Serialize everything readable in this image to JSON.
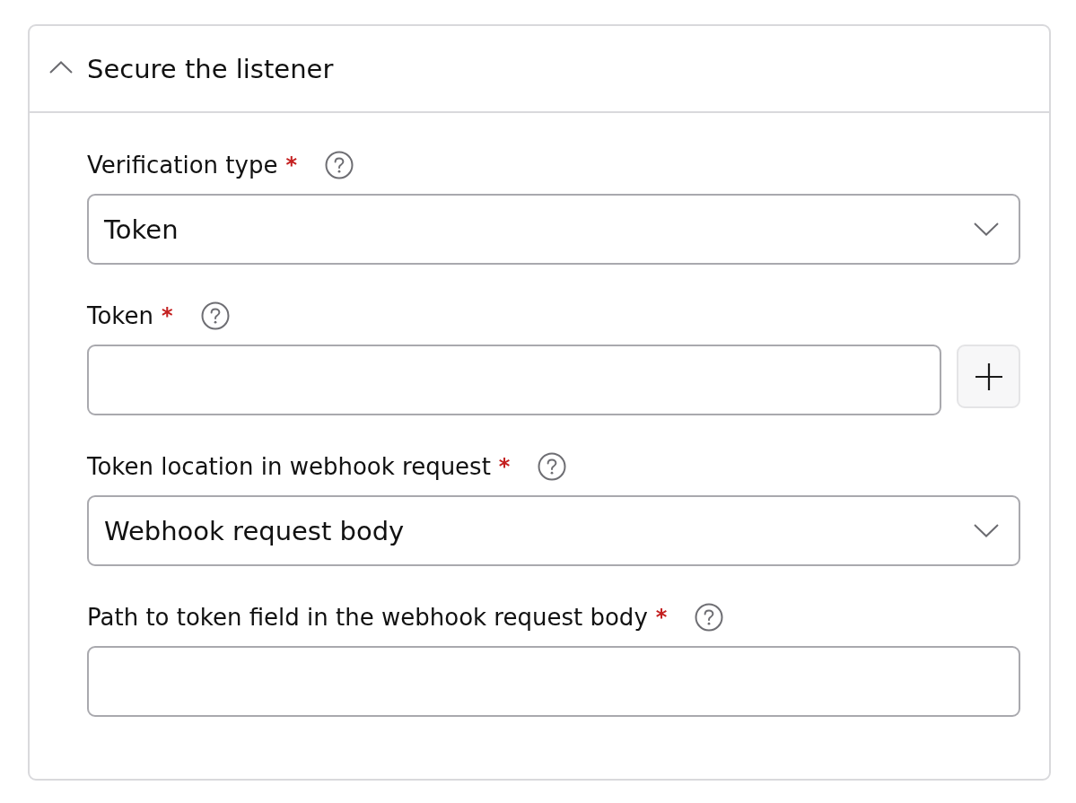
{
  "section": {
    "title": "Secure the listener",
    "expanded": true
  },
  "fields": [
    {
      "kind": "select",
      "label": "Verification type",
      "required_mark": "*",
      "value": "Token"
    },
    {
      "kind": "input",
      "label": "Token",
      "required_mark": "*",
      "add_button": true
    },
    {
      "kind": "select",
      "label": "Token location in webhook request",
      "required_mark": "*",
      "value": "Webhook request body"
    },
    {
      "kind": "input",
      "label": "Path to token field in the webhook request body",
      "required_mark": "*"
    }
  ]
}
